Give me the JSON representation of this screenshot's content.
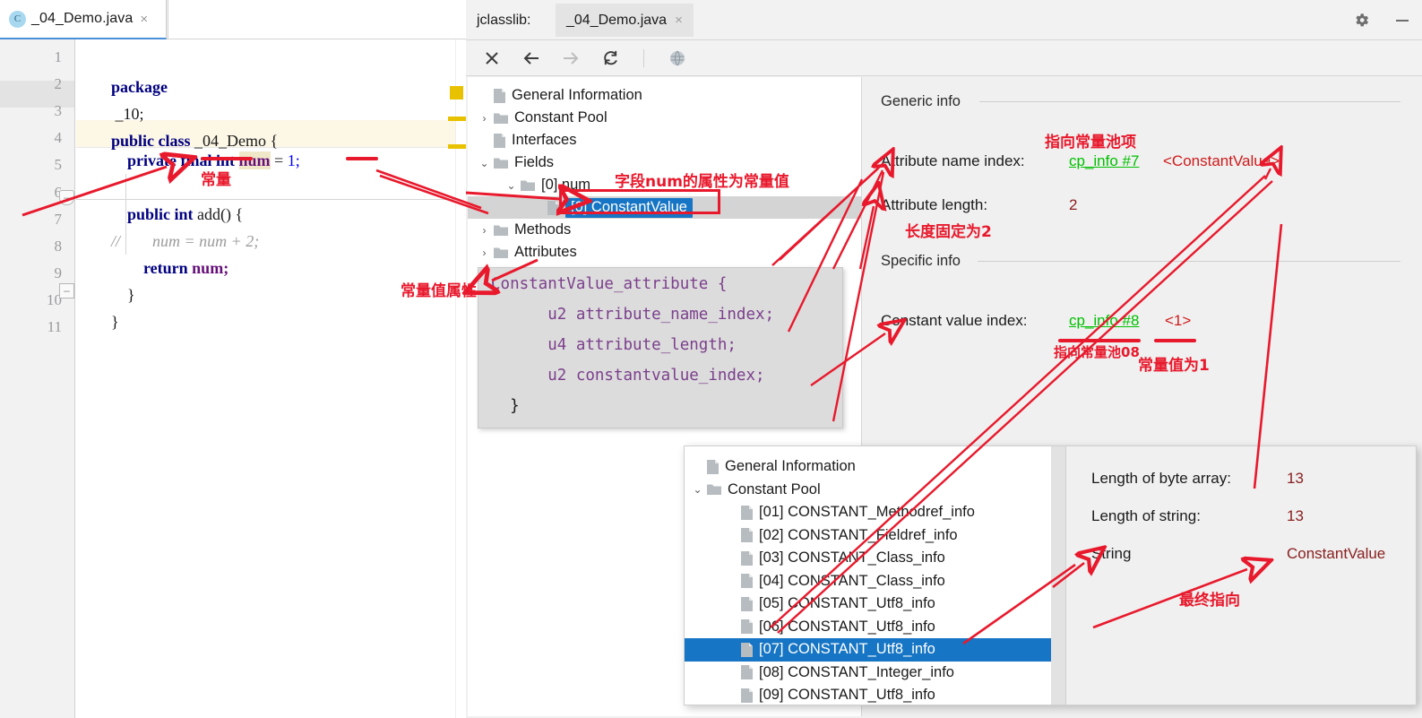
{
  "editor": {
    "tab": {
      "label": "_04_Demo.java",
      "icon": "class-file-icon",
      "close": "×"
    },
    "lines": [
      {
        "n": "1",
        "text": "package _10;"
      },
      {
        "n": "2",
        "text": ""
      },
      {
        "n": "3",
        "text": "public class _04_Demo {"
      },
      {
        "n": "4",
        "text": "    private final int num = 1;"
      },
      {
        "n": "5",
        "text": ""
      },
      {
        "n": "6",
        "text": "    public int add() {"
      },
      {
        "n": "7",
        "text": "//        num = num + 2;"
      },
      {
        "n": "8",
        "text": "        return num;"
      },
      {
        "n": "9",
        "text": "    }"
      },
      {
        "n": "10",
        "text": "}"
      },
      {
        "n": "11",
        "text": ""
      }
    ],
    "tokens": {
      "package": "package",
      "pkgname": "_10;",
      "public": "public",
      "class": "class",
      "classname": "_04_Demo",
      "obrace": "{",
      "private": "private",
      "final": "final",
      "int": "int",
      "num": "num",
      "eq": "=",
      "one": "1;",
      "add_sig": "add() {",
      "comment": "//",
      "comment_body": "num = num + 2;",
      "return": "return",
      "num2": "num;",
      "cbrace1": "}",
      "cbrace2": "}"
    }
  },
  "tool": {
    "title": "jclasslib:",
    "tab_label": "_04_Demo.java",
    "tab_close": "×",
    "window_buttons": [
      {
        "name": "settings-gear-icon",
        "glyph": "⚙"
      },
      {
        "name": "minimize-icon",
        "glyph": "—"
      }
    ],
    "toolbar": [
      {
        "name": "close-button",
        "glyph": "✕",
        "enabled": true
      },
      {
        "name": "back-button",
        "glyph": "←",
        "enabled": true
      },
      {
        "name": "forward-button",
        "glyph": "→",
        "enabled": false
      },
      {
        "name": "reload-button",
        "glyph": "↻",
        "enabled": true
      },
      {
        "name": "browse-web-button",
        "glyph": "ἱ0",
        "enabled": false
      }
    ]
  },
  "tree": {
    "items": [
      {
        "label": "General Information",
        "indent": 0,
        "arrow": "",
        "icon": "file-icon",
        "selected": false
      },
      {
        "label": "Constant Pool",
        "indent": 0,
        "arrow": "›",
        "icon": "folder-icon",
        "selected": false
      },
      {
        "label": "Interfaces",
        "indent": 0,
        "arrow": "",
        "icon": "file-icon",
        "selected": false
      },
      {
        "label": "Fields",
        "indent": 0,
        "arrow": "⌄",
        "icon": "folder-icon",
        "selected": false
      },
      {
        "label": "[0] num",
        "indent": 1,
        "arrow": "⌄",
        "icon": "folder-icon",
        "selected": false
      },
      {
        "label": "[0] ConstantValue",
        "indent": 2,
        "arrow": "",
        "icon": "file-icon",
        "selected": true
      },
      {
        "label": "Methods",
        "indent": 0,
        "arrow": "›",
        "icon": "folder-icon",
        "selected": false
      },
      {
        "label": "Attributes",
        "indent": 0,
        "arrow": "›",
        "icon": "folder-icon",
        "selected": false
      }
    ]
  },
  "detail": {
    "generic_title": "Generic info",
    "specific_title": "Specific info",
    "attribute_name_index_label": "Attribute name index:",
    "attribute_name_index_link": "cp_info #7",
    "attribute_name_index_value": "<ConstantValue>",
    "attribute_length_label": "Attribute length:",
    "attribute_length_value": "2",
    "constant_value_index_label": "Constant value index:",
    "constant_value_index_link": "cp_info #8",
    "constant_value_index_value": "<1>"
  },
  "snippet": {
    "lines": [
      "ConstantValue_attribute {",
      "      u2 attribute_name_index;",
      "      u4 attribute_length;",
      "      u2 constantvalue_index;",
      "  }"
    ]
  },
  "overlay": {
    "tree": [
      {
        "label": "General Information",
        "indent": 0,
        "arrow": "",
        "icon": "file-icon",
        "selected": false
      },
      {
        "label": "Constant Pool",
        "indent": 0,
        "arrow": "⌄",
        "icon": "folder-icon",
        "selected": false
      },
      {
        "label": "[01] CONSTANT_Methodref_info",
        "indent": 1,
        "arrow": "",
        "icon": "file-icon",
        "selected": false
      },
      {
        "label": "[02] CONSTANT_Fieldref_info",
        "indent": 1,
        "arrow": "",
        "icon": "file-icon",
        "selected": false
      },
      {
        "label": "[03] CONSTANT_Class_info",
        "indent": 1,
        "arrow": "",
        "icon": "file-icon",
        "selected": false
      },
      {
        "label": "[04] CONSTANT_Class_info",
        "indent": 1,
        "arrow": "",
        "icon": "file-icon",
        "selected": false
      },
      {
        "label": "[05] CONSTANT_Utf8_info",
        "indent": 1,
        "arrow": "",
        "icon": "file-icon",
        "selected": false
      },
      {
        "label": "[06] CONSTANT_Utf8_info",
        "indent": 1,
        "arrow": "",
        "icon": "file-icon",
        "selected": false
      },
      {
        "label": "[07] CONSTANT_Utf8_info",
        "indent": 1,
        "arrow": "",
        "icon": "file-icon",
        "selected": true
      },
      {
        "label": "[08] CONSTANT_Integer_info",
        "indent": 1,
        "arrow": "",
        "icon": "file-icon",
        "selected": false
      },
      {
        "label": "[09] CONSTANT_Utf8_info",
        "indent": 1,
        "arrow": "",
        "icon": "file-icon",
        "selected": false
      }
    ],
    "detail": {
      "byte_array_label": "Length of byte array:",
      "byte_array_value": "13",
      "string_length_label": "Length of string:",
      "string_length_value": "13",
      "string_label": "String",
      "string_value": "ConstantValue"
    }
  },
  "annotations": {
    "constant": "常量",
    "field_attr": "字段num的属性为常量值",
    "constvalue_attr": "常量值属性",
    "points_to_cp_item": "指向常量池项",
    "length_fixed_2": "长度固定为2",
    "points_to_cp08": "指向常量池08",
    "const_value_is_1": "常量值为1",
    "final_target": "最终指向"
  },
  "colors": {
    "annotation_red": "#e8192c",
    "link_green": "#00c000",
    "value_dark_red": "#8a2020",
    "selection_blue": "#1675c4",
    "marker_yellow": "#e8c200"
  }
}
